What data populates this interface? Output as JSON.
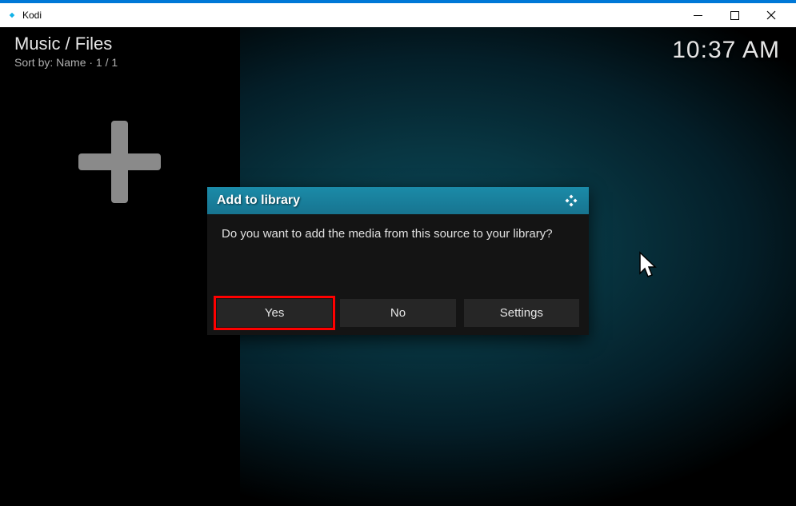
{
  "window": {
    "app_title": "Kodi"
  },
  "header": {
    "breadcrumb": "Music / Files",
    "sort_label": "Sort by: Name  ·  1 / 1"
  },
  "clock": {
    "time": "10:37 AM"
  },
  "dialog": {
    "title": "Add to library",
    "message": "Do you want to add the media from this source to your library?",
    "buttons": {
      "yes": "Yes",
      "no": "No",
      "settings": "Settings"
    }
  }
}
